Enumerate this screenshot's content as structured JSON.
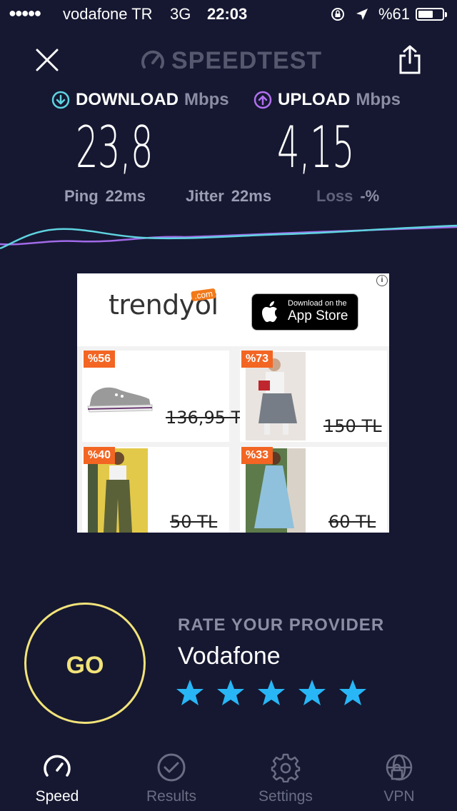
{
  "status_bar": {
    "signal_dots": "●●●●●",
    "carrier": "vodafone TR",
    "network": "3G",
    "time": "22:03",
    "battery_pct": "%61",
    "battery_level": 0.61
  },
  "header": {
    "logo": "SPEEDTEST",
    "icons": [
      "close-icon",
      "speedometer-icon",
      "share-icon"
    ]
  },
  "results": {
    "download_label": "DOWNLOAD",
    "download_unit": "Mbps",
    "download_value": "23,8",
    "upload_label": "UPLOAD",
    "upload_unit": "Mbps",
    "upload_value": "4,15",
    "ping_label": "Ping",
    "ping_value": "22ms",
    "jitter_label": "Jitter",
    "jitter_value": "22ms",
    "loss_label": "Loss",
    "loss_value": "-%"
  },
  "ad": {
    "brand": "trendyol",
    "brand_suffix": ".com",
    "appstore_small": "Download on the",
    "appstore_big": "App Store",
    "info": "i",
    "products": [
      {
        "discount": "%56",
        "price": "136,95 TL"
      },
      {
        "discount": "%73",
        "price": "150 TL"
      },
      {
        "discount": "%40",
        "price": "50 TL"
      },
      {
        "discount": "%33",
        "price": "60 TL"
      }
    ]
  },
  "go_button": "GO",
  "rating": {
    "title": "RATE YOUR PROVIDER",
    "provider": "Vodafone",
    "stars": 5
  },
  "tabs": [
    {
      "label": "Speed",
      "active": true
    },
    {
      "label": "Results",
      "active": false
    },
    {
      "label": "Settings",
      "active": false
    },
    {
      "label": "VPN",
      "active": false
    }
  ],
  "colors": {
    "background": "#151830",
    "download_accent": "#5fd3e0",
    "upload_accent": "#b070f0",
    "go_ring": "#f1e27a",
    "star": "#29b6f6",
    "badge": "#f26522"
  }
}
